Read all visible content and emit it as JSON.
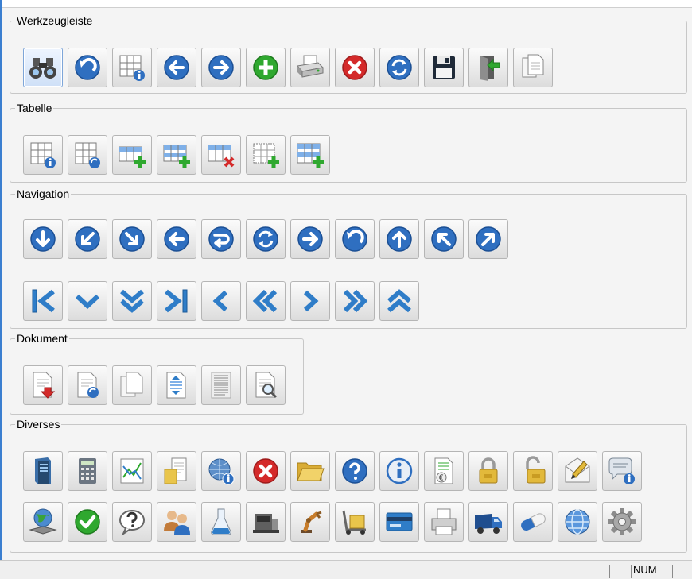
{
  "groups": {
    "werkzeugleiste": {
      "title": "Werkzeugleiste"
    },
    "tabelle": {
      "title": "Tabelle"
    },
    "navigation": {
      "title": "Navigation"
    },
    "dokument": {
      "title": "Dokument"
    },
    "diverses": {
      "title": "Diverses"
    }
  },
  "statusbar": {
    "num": "NUM"
  },
  "colors": {
    "circle_blue": "#2f6fc0",
    "green": "#2fa82f",
    "red": "#d42a2a",
    "chevron_blue": "#2f7dc8",
    "folder_yellow": "#e9c54b",
    "selected_bg": "#cfe0f7"
  }
}
